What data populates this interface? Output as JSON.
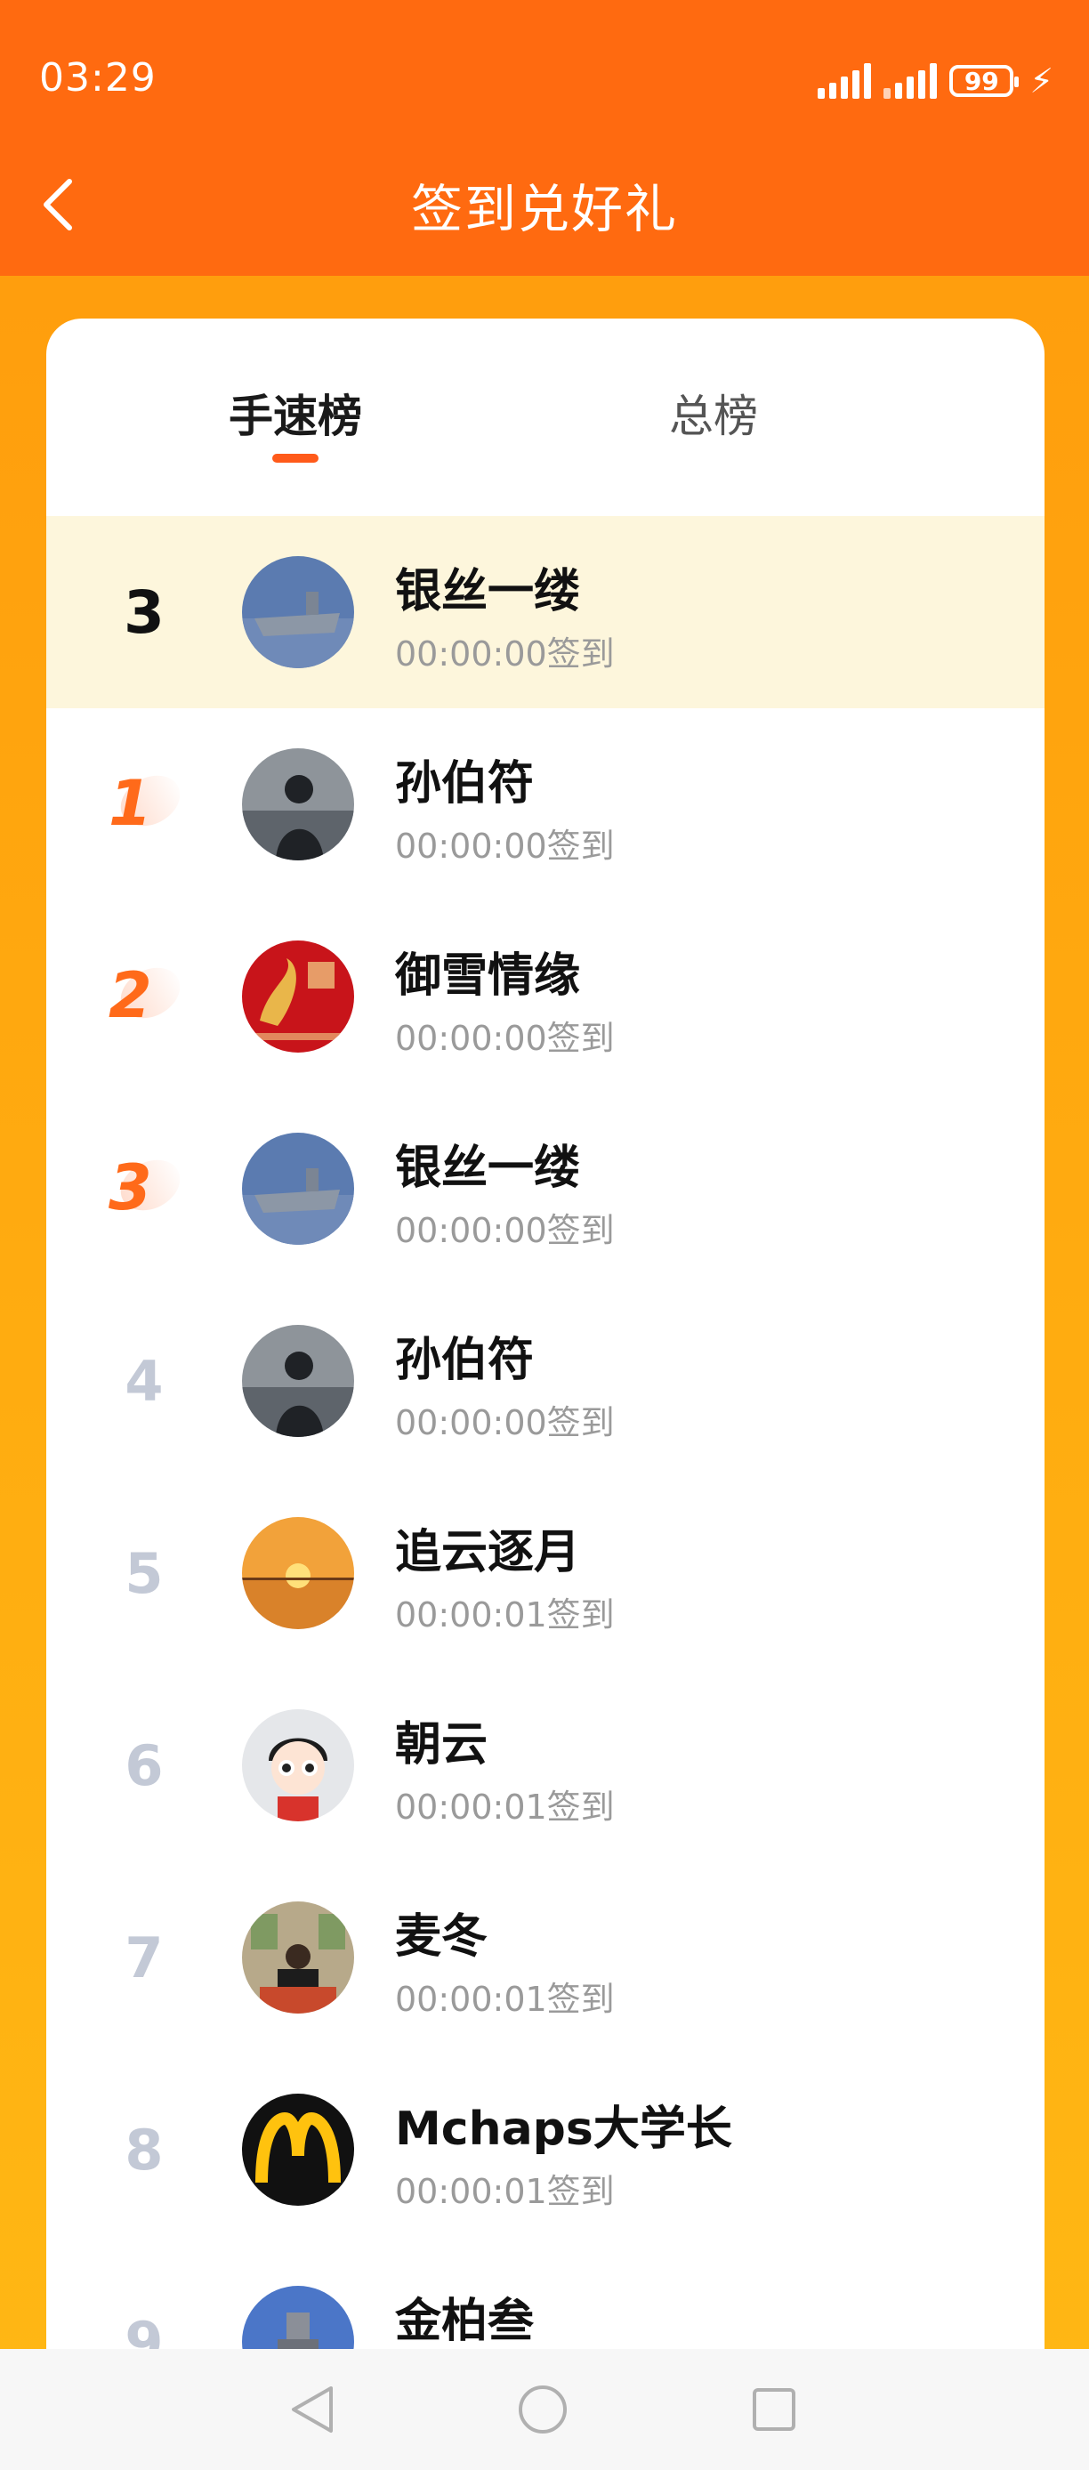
{
  "status_bar": {
    "time": "03:29",
    "battery": "99"
  },
  "header": {
    "title": "签到兑好礼"
  },
  "tabs": [
    {
      "label": "手速榜",
      "active": true
    },
    {
      "label": "总榜",
      "active": false
    }
  ],
  "my_rank": {
    "rank": "3",
    "name": "银丝一缕",
    "time_text": "00:00:00签到",
    "avatar": "aircraft-carrier-avatar"
  },
  "leaderboard": [
    {
      "rank": "1",
      "name": "孙伯符",
      "time_text": "00:00:00签到",
      "avatar": "silhouette-avatar"
    },
    {
      "rank": "2",
      "name": "御雪情缘",
      "time_text": "00:00:00签到",
      "avatar": "red-dragon-avatar"
    },
    {
      "rank": "3",
      "name": "银丝一缕",
      "time_text": "00:00:00签到",
      "avatar": "aircraft-carrier-avatar"
    },
    {
      "rank": "4",
      "name": "孙伯符",
      "time_text": "00:00:00签到",
      "avatar": "silhouette-avatar"
    },
    {
      "rank": "5",
      "name": "追云逐月",
      "time_text": "00:00:01签到",
      "avatar": "sunset-avatar"
    },
    {
      "rank": "6",
      "name": "朝云",
      "time_text": "00:00:01签到",
      "avatar": "cartoon-girl-avatar"
    },
    {
      "rank": "7",
      "name": "麦冬",
      "time_text": "00:00:01签到",
      "avatar": "person-at-desk-avatar"
    },
    {
      "rank": "8",
      "name": "Mchaps大学长",
      "time_text": "00:00:01签到",
      "avatar": "mcdonalds-logo-avatar"
    },
    {
      "rank": "9",
      "name": "金柏叁",
      "time_text": "",
      "avatar": "tower-avatar"
    }
  ],
  "colors": {
    "header_bg": "#ff6a10",
    "accent": "#ff5a1a",
    "my_row_bg": "#fdf6dc",
    "rank_gray": "#c3c9d6"
  }
}
